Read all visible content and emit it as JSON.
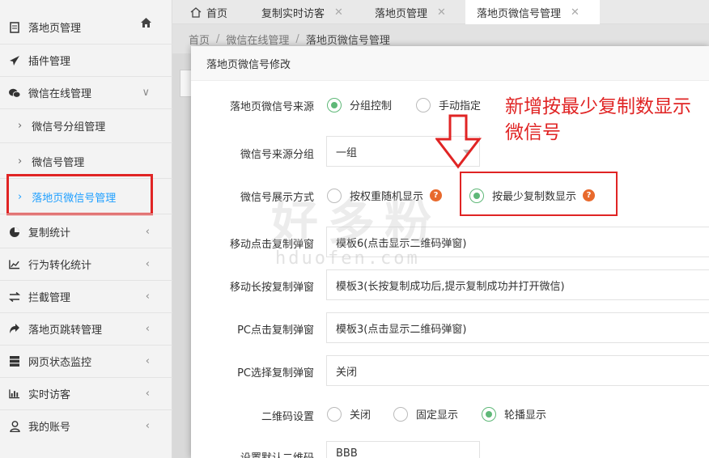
{
  "sidebar": {
    "items": [
      {
        "label": "落地页管理",
        "icon": "document-icon"
      },
      {
        "label": "插件管理",
        "icon": "paper-plane-icon"
      },
      {
        "label": "微信在线管理",
        "icon": "wechat-icon"
      },
      {
        "label": "微信号分组管理"
      },
      {
        "label": "微信号管理"
      },
      {
        "label": "落地页微信号管理"
      },
      {
        "label": "复制统计",
        "icon": "pie-chart-icon"
      },
      {
        "label": "行为转化统计",
        "icon": "line-chart-icon"
      },
      {
        "label": "拦截管理",
        "icon": "exchange-icon"
      },
      {
        "label": "落地页跳转管理",
        "icon": "share-icon"
      },
      {
        "label": "网页状态监控",
        "icon": "server-icon"
      },
      {
        "label": "实时访客",
        "icon": "bar-chart-icon"
      },
      {
        "label": "我的账号",
        "icon": "user-icon"
      }
    ]
  },
  "tabs": [
    {
      "label": "首页"
    },
    {
      "label": "复制实时访客"
    },
    {
      "label": "落地页管理"
    },
    {
      "label": "落地页微信号管理"
    }
  ],
  "breadcrumb": {
    "home": "首页",
    "level1": "微信在线管理",
    "current": "落地页微信号管理"
  },
  "modal": {
    "title": "落地页微信号修改",
    "source_label": "落地页微信号来源",
    "source_opt1": "分组控制",
    "source_opt2": "手动指定",
    "group_label": "微信号来源分组",
    "group_value": "一组",
    "display_label": "微信号展示方式",
    "display_opt1": "按权重随机显示",
    "display_opt2": "按最少复制数显示",
    "mobile_click_label": "移动点击复制弹窗",
    "mobile_click_value": "模板6(点击显示二维码弹窗)",
    "mobile_long_label": "移动长按复制弹窗",
    "mobile_long_value": "模板3(长按复制成功后,提示复制成功并打开微信)",
    "pc_click_label": "PC点击复制弹窗",
    "pc_click_value": "模板3(点击显示二维码弹窗)",
    "pc_select_label": "PC选择复制弹窗",
    "pc_select_value": "关闭",
    "qr_label": "二维码设置",
    "qr_opt1": "关闭",
    "qr_opt2": "固定显示",
    "qr_opt3": "轮播显示",
    "default_qr_label": "设置默认二维码",
    "default_qr_value": "BBB",
    "help": "?"
  },
  "annotation": {
    "line1": "新增按最少复制数显示",
    "line2": "微信号"
  },
  "watermark": {
    "cn": "好多粉",
    "url": "hduofen.com"
  },
  "colors": {
    "accent": "#1e9fff",
    "radio_on": "#5fb878",
    "annotation_red": "#e02424",
    "help_orange": "#e8692c"
  }
}
